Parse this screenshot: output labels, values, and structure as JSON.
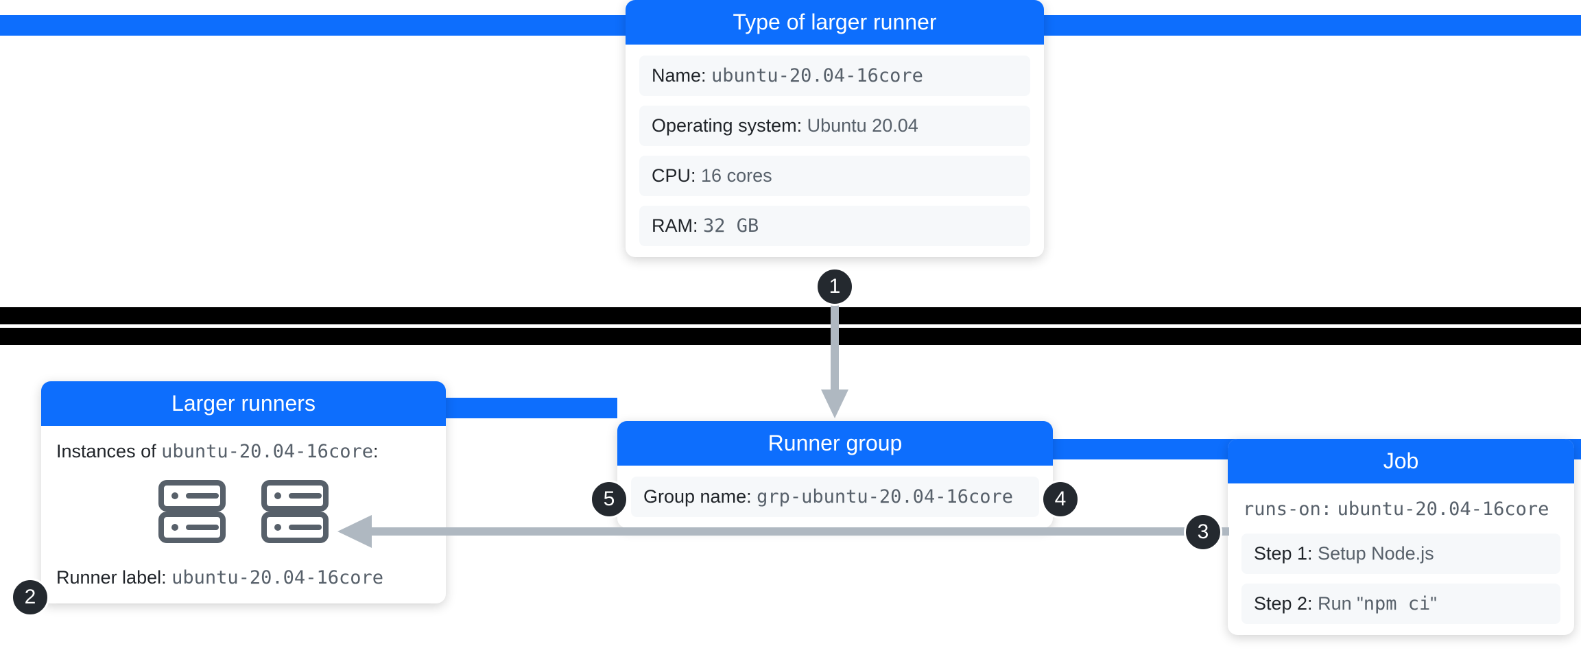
{
  "type_card": {
    "title": "Type of larger runner",
    "name_label": "Name:",
    "name_value": "ubuntu-20.04-16core",
    "os_label": "Operating system:",
    "os_value": "Ubuntu 20.04",
    "cpu_label": "CPU:",
    "cpu_value": "16 cores",
    "ram_label": "RAM:",
    "ram_value": "32 GB"
  },
  "larger_runners_card": {
    "title": "Larger runners",
    "instances_label": "Instances of",
    "instances_value": "ubuntu-20.04-16core",
    "instances_colon": ":",
    "runner_label_label": "Runner label:",
    "runner_label_value": "ubuntu-20.04-16core"
  },
  "group_card": {
    "title": "Runner group",
    "group_name_label": "Group name:",
    "group_name_value": "grp-ubuntu-20.04-16core"
  },
  "job_card": {
    "title": "Job",
    "runs_on_label": "runs-on:",
    "runs_on_value": "ubuntu-20.04-16core",
    "step1_label": "Step 1:",
    "step1_value": "Setup Node.js",
    "step2_label": "Step 2:",
    "step2_value_prefix": "Run \"",
    "step2_value_code": "npm ci",
    "step2_value_suffix": "\""
  },
  "badges": {
    "b1": "1",
    "b2": "2",
    "b3": "3",
    "b4": "4",
    "b5": "5"
  }
}
